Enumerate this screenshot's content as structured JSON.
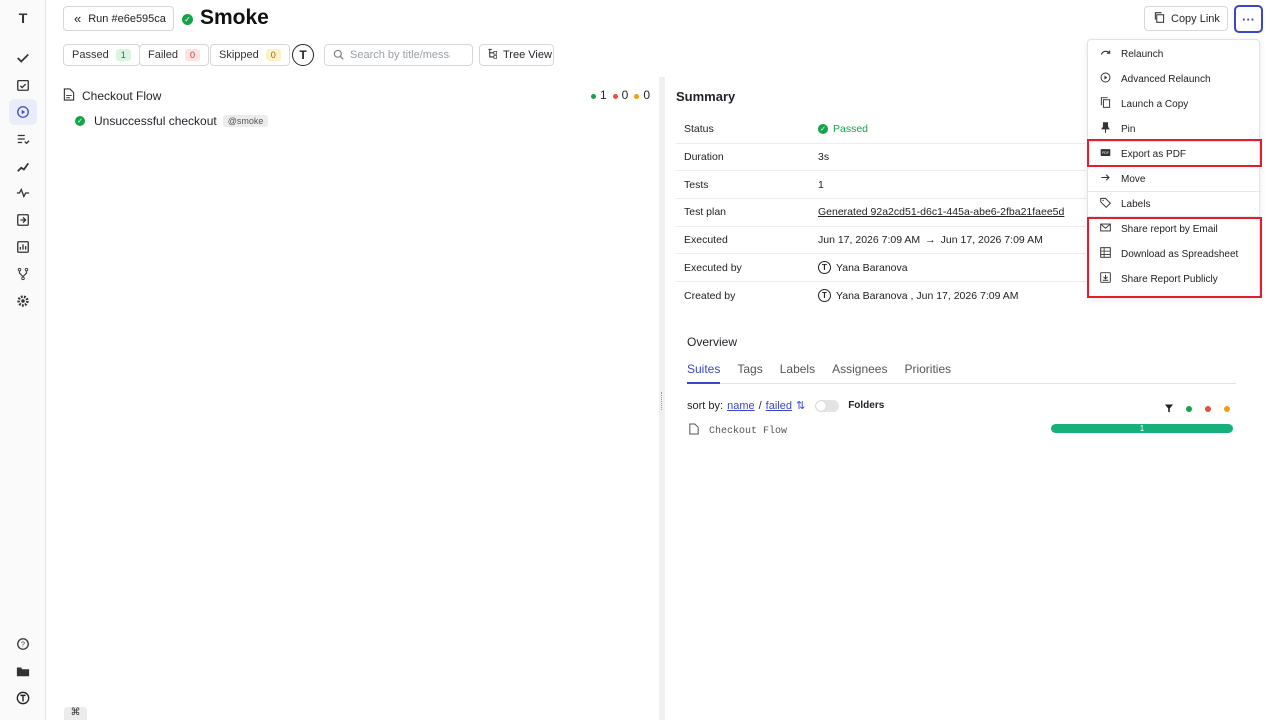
{
  "header": {
    "run_label": "Run #e6e595ca",
    "title": "Smoke",
    "copy_link": "Copy Link",
    "more": "···"
  },
  "filters": {
    "passed": {
      "label": "Passed",
      "count": "1"
    },
    "failed": {
      "label": "Failed",
      "count": "0"
    },
    "skipped": {
      "label": "Skipped",
      "count": "0"
    },
    "search_placeholder": "Search by title/message",
    "tree_view": "Tree View"
  },
  "tree": {
    "suite": "Checkout Flow",
    "counts": [
      "1",
      "0",
      "0"
    ],
    "test": {
      "title": "Unsuccessful checkout",
      "tag": "@smoke"
    }
  },
  "summary": {
    "title": "Summary",
    "rows": [
      {
        "key": "Status",
        "value": "Passed"
      },
      {
        "key": "Duration",
        "value": "3s"
      },
      {
        "key": "Tests",
        "value": "1"
      },
      {
        "key": "Test plan",
        "value": "Generated 92a2cd51-d6c1-445a-abe6-2fba21faee5d"
      },
      {
        "key": "Executed",
        "value": "Jun 17, 2026 7:09 AM",
        "value2": "Jun 17, 2026 7:09 AM"
      },
      {
        "key": "Executed by",
        "value": "Yana Baranova"
      },
      {
        "key": "Created by",
        "value": "Yana Baranova , Jun 17, 2026 7:09 AM"
      }
    ]
  },
  "overview": {
    "title": "Overview",
    "tabs": [
      "Suites",
      "Tags",
      "Labels",
      "Assignees",
      "Priorities"
    ],
    "sort_label": "sort by:",
    "sort_name": "name",
    "sort_sep": "/",
    "sort_failed": "failed",
    "folders": "Folders",
    "suite_name": "Checkout Flow",
    "suite_passed": "1",
    "suite_passed_fraction": 1.0
  },
  "menu": {
    "items": [
      "Relaunch",
      "Advanced Relaunch",
      "Launch a Copy",
      "Pin",
      "Export as PDF",
      "Move",
      "Labels",
      "Share report by Email",
      "Download as Spreadsheet",
      "Share Report Publicly"
    ]
  },
  "shortcut": "⌘",
  "colors": {
    "accent": "#3b46c7",
    "passed": "#16a34a",
    "failed": "#e74c3c",
    "skipped": "#f59e0b",
    "highlight": "#e11d2e"
  }
}
